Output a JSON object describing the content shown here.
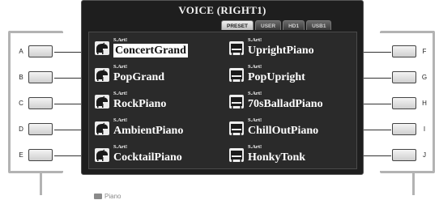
{
  "lcd": {
    "title": "VOICE (RIGHT1)",
    "tabs": [
      {
        "label": "PRESET",
        "active": true
      },
      {
        "label": "USER",
        "active": false
      },
      {
        "label": "HD1",
        "active": false
      },
      {
        "label": "USB1",
        "active": false
      }
    ],
    "folder_label": "Piano"
  },
  "voices": [
    {
      "button": "A",
      "badge": "S.Art!",
      "name": "ConcertGrand",
      "icon": "grand-piano-icon",
      "selected": true
    },
    {
      "button": "B",
      "badge": "S.Art!",
      "name": "PopGrand",
      "icon": "grand-piano-icon",
      "selected": false
    },
    {
      "button": "C",
      "badge": "S.Art!",
      "name": "RockPiano",
      "icon": "grand-piano-icon",
      "selected": false
    },
    {
      "button": "D",
      "badge": "S.Art!",
      "name": "AmbientPiano",
      "icon": "grand-piano-icon",
      "selected": false
    },
    {
      "button": "E",
      "badge": "S.Art!",
      "name": "CocktailPiano",
      "icon": "grand-piano-icon",
      "selected": false
    },
    {
      "button": "F",
      "badge": "S.Art!",
      "name": "UprightPiano",
      "icon": "upright-piano-icon",
      "selected": false
    },
    {
      "button": "G",
      "badge": "S.Art!",
      "name": "PopUpright",
      "icon": "upright-piano-icon",
      "selected": false
    },
    {
      "button": "H",
      "badge": "S.Art!",
      "name": "70sBalladPiano",
      "icon": "upright-piano-icon",
      "selected": false
    },
    {
      "button": "I",
      "badge": "S.Art!",
      "name": "ChillOutPiano",
      "icon": "upright-piano-icon",
      "selected": false
    },
    {
      "button": "J",
      "badge": "S.Art!",
      "name": "HonkyTonk",
      "icon": "upright-piano-icon",
      "selected": false
    }
  ],
  "side_buttons": {
    "left": [
      "A",
      "B",
      "C",
      "D",
      "E"
    ],
    "right": [
      "F",
      "G",
      "H",
      "I",
      "J"
    ]
  },
  "colors": {
    "lcd_background": "#1e1e1e",
    "panel_border": "#b3b3b3",
    "selected_highlight": "#ffffff"
  }
}
